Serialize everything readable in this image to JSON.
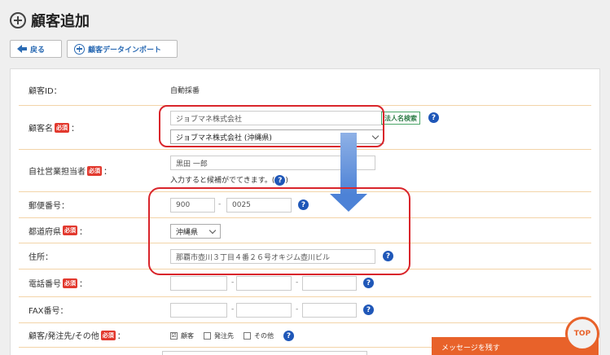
{
  "page": {
    "title": "顧客追加"
  },
  "toolbar": {
    "back_label": "戻る",
    "import_label": "顧客データインポート"
  },
  "form": {
    "customer_id": {
      "label": "顧客ID：",
      "value": "自動採番"
    },
    "customer_name": {
      "label": "顧客名",
      "required": "必須",
      "colon": "：",
      "value": "ジョブマネ株式会社",
      "select": "ジョブマネ株式会社 (沖縄県)",
      "corp_search": "法人名検索",
      "help": "?"
    },
    "sales_rep": {
      "label": "自社営業担当者",
      "required": "必須",
      "colon": "：",
      "value": "黒田 一郎",
      "hint": "入力すると候補がでてきます。(",
      "hint_close": ")",
      "help": "?"
    },
    "postal": {
      "label": "郵便番号：",
      "part1": "900",
      "sep": "-",
      "part2": "0025",
      "help": "?"
    },
    "prefecture": {
      "label": "都道府県",
      "required": "必須",
      "colon": "：",
      "value": "沖縄県"
    },
    "address": {
      "label": "住所：",
      "value": "那覇市壺川３丁目４番２６号オキジム壺川ビル",
      "help": "?"
    },
    "phone": {
      "label": "電話番号",
      "required": "必須",
      "colon": "：",
      "sep": "-",
      "help": "?"
    },
    "fax": {
      "label": "FAX番号：",
      "sep": "-",
      "help": "?"
    },
    "category": {
      "label": "顧客/発注先/その他",
      "required": "必須",
      "colon": "：",
      "opt1": "顧客",
      "opt2": "発注先",
      "opt3": "その他",
      "check": "☑",
      "help": "?"
    }
  },
  "footer": {
    "message_label": "メッセージを残す",
    "top_label": "TOP"
  },
  "colors": {
    "accent_red": "#d9252b",
    "help_blue": "#1f57b8",
    "link_blue": "#2a6ab3",
    "orange": "#e8622a"
  }
}
